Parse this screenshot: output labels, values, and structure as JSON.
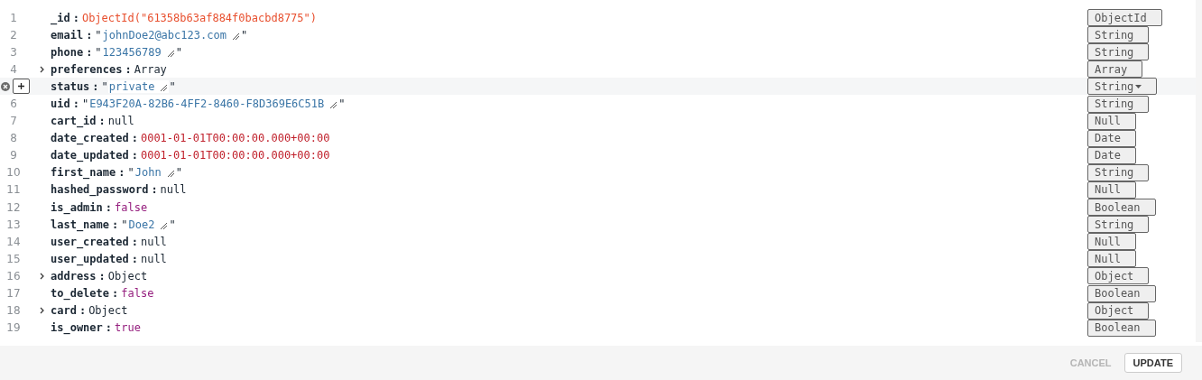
{
  "fields": [
    {
      "line": "1",
      "key": "_id",
      "kind": "objectid",
      "value": "ObjectId(\"61358b63af884f0bacbd8775\")",
      "type": "ObjectId",
      "hovered": false
    },
    {
      "line": "2",
      "key": "email",
      "kind": "string",
      "quote_open": "\"",
      "value": "johnDoe2@abc123.com",
      "quote_close": "\"",
      "type": "String",
      "hovered": false
    },
    {
      "line": "3",
      "key": "phone",
      "kind": "string",
      "quote_open": "\"",
      "value": "123456789",
      "quote_close": "\"",
      "type": "String",
      "hovered": false
    },
    {
      "line": "4",
      "key": "preferences",
      "kind": "array",
      "value": "Array",
      "expanded": false,
      "type": "Array",
      "hovered": false
    },
    {
      "key": "status",
      "kind": "string",
      "quote_open": "\"",
      "value": "private",
      "quote_close": "\"",
      "type": "String",
      "hovered": true
    },
    {
      "line": "6",
      "key": "uid",
      "kind": "string",
      "quote_open": "\"",
      "value": "E943F20A-82B6-4FF2-8460-F8D369E6C51B",
      "quote_close": "\"",
      "type": "String",
      "hovered": false
    },
    {
      "line": "7",
      "key": "cart_id",
      "kind": "null",
      "value": "null",
      "type": "Null",
      "hovered": false
    },
    {
      "line": "8",
      "key": "date_created",
      "kind": "date",
      "value": "0001-01-01T00:00:00.000+00:00",
      "type": "Date",
      "hovered": false
    },
    {
      "line": "9",
      "key": "date_updated",
      "kind": "date",
      "value": "0001-01-01T00:00:00.000+00:00",
      "type": "Date",
      "hovered": false
    },
    {
      "line": "10",
      "key": "first_name",
      "kind": "string",
      "quote_open": "\"",
      "value": "John",
      "quote_close": "\"",
      "type": "String",
      "hovered": false
    },
    {
      "line": "11",
      "key": "hashed_password",
      "kind": "null",
      "value": "null",
      "type": "Null",
      "hovered": false
    },
    {
      "line": "12",
      "key": "is_admin",
      "kind": "boolean",
      "value": "false",
      "type": "Boolean",
      "hovered": false
    },
    {
      "line": "13",
      "key": "last_name",
      "kind": "string",
      "quote_open": "\"",
      "value": "Doe2",
      "quote_close": "\"",
      "type": "String",
      "hovered": false
    },
    {
      "line": "14",
      "key": "user_created",
      "kind": "null",
      "value": "null",
      "type": "Null",
      "hovered": false
    },
    {
      "line": "15",
      "key": "user_updated",
      "kind": "null",
      "value": "null",
      "type": "Null",
      "hovered": false
    },
    {
      "line": "16",
      "key": "address",
      "kind": "object",
      "value": "Object",
      "expanded": false,
      "type": "Object",
      "hovered": false
    },
    {
      "line": "17",
      "key": "to_delete",
      "kind": "boolean",
      "value": "false",
      "type": "Boolean",
      "hovered": false
    },
    {
      "line": "18",
      "key": "card",
      "kind": "object",
      "value": "Object",
      "expanded": false,
      "type": "Object",
      "hovered": false
    },
    {
      "line": "19",
      "key": "is_owner",
      "kind": "boolean",
      "value": "true",
      "type": "Boolean",
      "hovered": false
    }
  ],
  "separator": ":",
  "buttons": {
    "cancel": "CANCEL",
    "update": "UPDATE"
  }
}
